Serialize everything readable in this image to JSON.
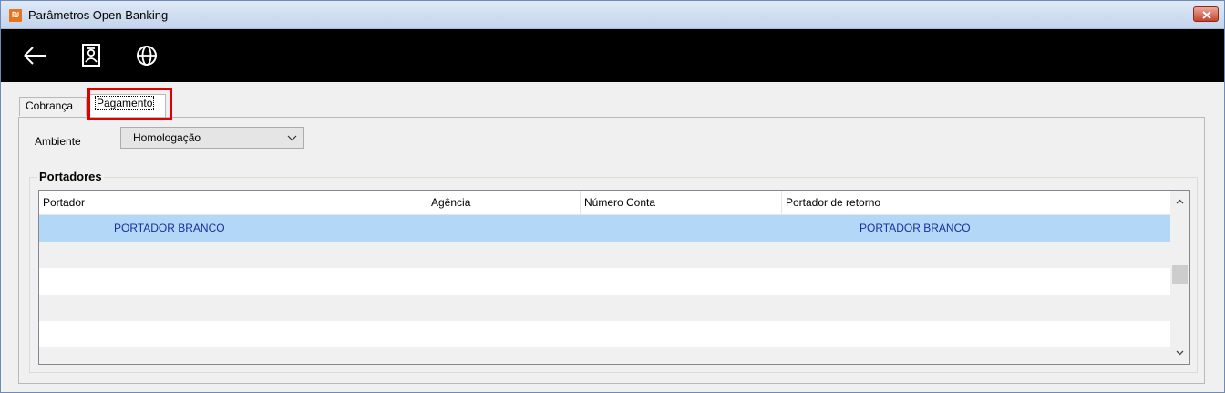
{
  "window": {
    "title": "Parâmetros Open Banking",
    "app_icon": "app-logo-icon"
  },
  "toolbar": {
    "buttons": [
      {
        "icon": "arrow-left-icon"
      },
      {
        "icon": "id-card-icon"
      },
      {
        "icon": "globe-icon"
      }
    ]
  },
  "tabs": [
    {
      "label": "Cobrança",
      "active": false
    },
    {
      "label": "Pagamento",
      "active": true
    }
  ],
  "ambiente": {
    "label": "Ambiente",
    "value": "Homologação"
  },
  "portadores": {
    "title": "Portadores",
    "columns": [
      "Portador",
      "Agência",
      "Número Conta",
      "Portador de retorno"
    ],
    "rows": [
      {
        "portador": "PORTADOR BRANCO",
        "agencia": "",
        "numero_conta": "",
        "portador_retorno": "PORTADOR BRANCO",
        "selected": true
      }
    ]
  },
  "colors": {
    "selection": "#b3d7f6",
    "row_text": "#1a2f9e",
    "highlight": "#e00000",
    "toolbar": "#000000"
  }
}
